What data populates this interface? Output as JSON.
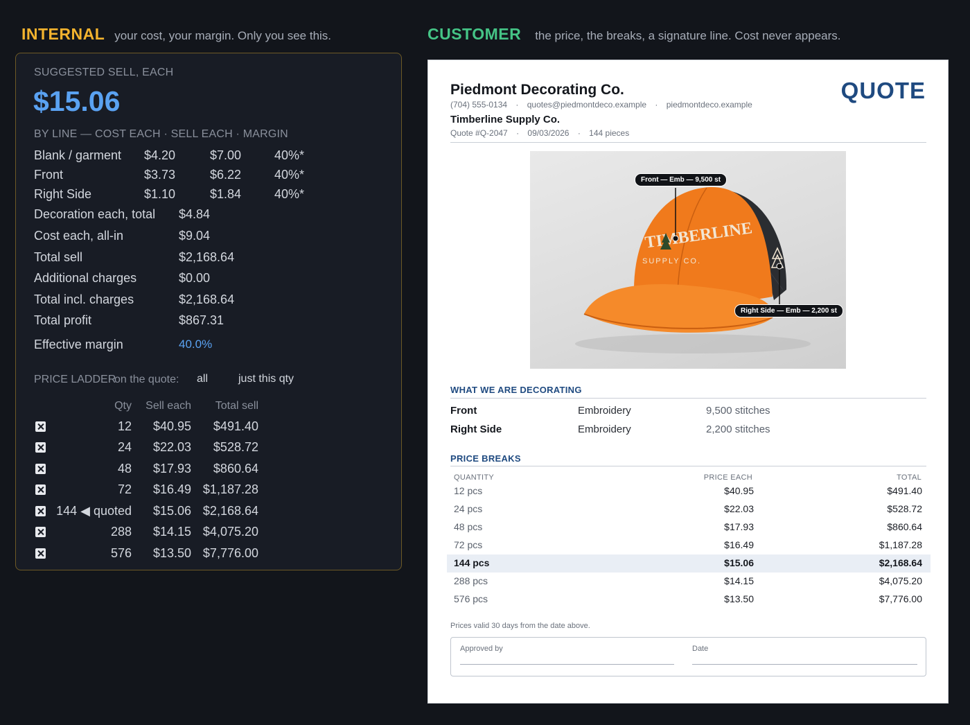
{
  "internal_header": {
    "tag": "INTERNAL",
    "subtitle": "your cost, your margin. Only you see this."
  },
  "customer_header": {
    "tag": "CUSTOMER",
    "subtitle": "the price, the breaks, a signature line. Cost never appears."
  },
  "internal": {
    "suggested_label": "SUGGESTED SELL, EACH",
    "suggested_price": "$15.06",
    "by_line_label": "BY LINE — COST EACH  ·  SELL EACH  ·  MARGIN",
    "lines": [
      {
        "name": "Blank / garment",
        "cost": "$4.20",
        "sell": "$7.00",
        "margin": "40%*"
      },
      {
        "name": "Front",
        "cost": "$3.73",
        "sell": "$6.22",
        "margin": "40%*"
      },
      {
        "name": "Right Side",
        "cost": "$1.10",
        "sell": "$1.84",
        "margin": "40%*"
      }
    ],
    "totals": [
      {
        "label": "Decoration each, total",
        "value": "$4.84"
      },
      {
        "label": "Cost each, all-in",
        "value": "$9.04"
      },
      {
        "label": "Total sell",
        "value": "$2,168.64"
      },
      {
        "label": "Additional charges",
        "value": "$0.00"
      },
      {
        "label": "Total incl. charges",
        "value": "$2,168.64"
      },
      {
        "label": "Total profit",
        "value": "$867.31"
      }
    ],
    "effective_margin": {
      "label": "Effective margin",
      "value": "40.0%"
    },
    "ladder": {
      "title": "PRICE LADDER",
      "on_quote_label": "on the quote:",
      "option_all": "all",
      "option_just": "just this qty",
      "col_qty": "Qty",
      "col_sell": "Sell each",
      "col_total": "Total sell",
      "rows": [
        {
          "qty": "12",
          "sell": "$40.95",
          "total": "$491.40"
        },
        {
          "qty": "24",
          "sell": "$22.03",
          "total": "$528.72"
        },
        {
          "qty": "48",
          "sell": "$17.93",
          "total": "$860.64"
        },
        {
          "qty": "72",
          "sell": "$16.49",
          "total": "$1,187.28"
        },
        {
          "qty": "144 ◀ quoted",
          "sell": "$15.06",
          "total": "$2,168.64"
        },
        {
          "qty": "288",
          "sell": "$14.15",
          "total": "$4,075.20"
        },
        {
          "qty": "576",
          "sell": "$13.50",
          "total": "$7,776.00"
        }
      ]
    }
  },
  "quote": {
    "company": "Piedmont Decorating Co.",
    "phone": "(704) 555-0134",
    "email": "quotes@piedmontdeco.example",
    "website": "piedmontdeco.example",
    "client": "Timberline Supply Co.",
    "quote_no": "Quote #Q-2047",
    "date": "09/03/2026",
    "pieces": "144 pieces",
    "title": "QUOTE",
    "sep": "·",
    "photo": {
      "callout_front": "Front — Emb — 9,500 st",
      "callout_side": "Right Side — Emb — 2,200 st",
      "cap_text": "TIMBERLINE",
      "cap_sub": "SUPPLY CO.",
      "cap_color": "#f07a1c"
    },
    "decorating_title": "WHAT WE ARE DECORATING",
    "decorations": [
      {
        "location": "Front",
        "method": "Embroidery",
        "detail": "9,500 stitches"
      },
      {
        "location": "Right Side",
        "method": "Embroidery",
        "detail": "2,200 stitches"
      }
    ],
    "breaks_title": "PRICE BREAKS",
    "breaks_head": {
      "qty": "QUANTITY",
      "price": "PRICE EACH",
      "total": "TOTAL"
    },
    "breaks": [
      {
        "qty": "12 pcs",
        "price": "$40.95",
        "total": "$491.40"
      },
      {
        "qty": "24 pcs",
        "price": "$22.03",
        "total": "$528.72"
      },
      {
        "qty": "48 pcs",
        "price": "$17.93",
        "total": "$860.64"
      },
      {
        "qty": "72 pcs",
        "price": "$16.49",
        "total": "$1,187.28"
      },
      {
        "qty": "144 pcs",
        "price": "$15.06",
        "total": "$2,168.64"
      },
      {
        "qty": "288 pcs",
        "price": "$14.15",
        "total": "$4,075.20"
      },
      {
        "qty": "576 pcs",
        "price": "$13.50",
        "total": "$7,776.00"
      }
    ],
    "validity": "Prices valid 30 days from the date above.",
    "approved_label": "Approved by",
    "date_label": "Date"
  },
  "colors": {
    "internal_accent": "#f3b32e",
    "customer_accent": "#45c486",
    "price_blue": "#5aa2f2",
    "quote_blue": "#1f4a80"
  }
}
